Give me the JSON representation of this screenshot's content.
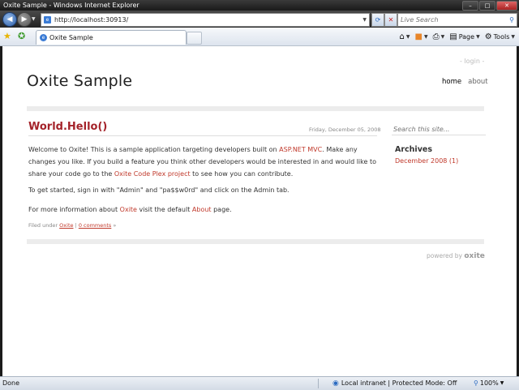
{
  "window": {
    "title": "Oxite Sample - Windows Internet Explorer",
    "minimize_glyph": "–",
    "maximize_glyph": "□",
    "close_glyph": "✕"
  },
  "address_bar": {
    "url": "http://localhost:30913/",
    "search_placeholder": "Live Search"
  },
  "tab": {
    "label": "Oxite Sample"
  },
  "command_bar": {
    "page_label": "Page",
    "tools_label": "Tools"
  },
  "site": {
    "login_label": "- login -",
    "title": "Oxite Sample",
    "nav": [
      "home",
      "about"
    ],
    "search_placeholder": "Search this site...",
    "powered_by_label": "powered by",
    "powered_by_brand": "oxite"
  },
  "post": {
    "title": "World.Hello()",
    "date": "Friday, December 05, 2008",
    "p1_a": "Welcome to Oxite!  This is a sample application targeting developers built on ",
    "p1_link1": "ASP.NET MVC",
    "p1_b": ".  Make any changes you like.  If you build a feature you think other developers would be interested in and would like to share your code go to the ",
    "p1_link2": "Oxite Code Plex project",
    "p1_c": " to see how you can contribute.",
    "p2": "To get started, sign in with \"Admin\" and \"pa$$w0rd\" and click on the Admin tab.",
    "p3_a": "For more information about ",
    "p3_link1": "Oxite",
    "p3_b": " visit the default ",
    "p3_link2": "About",
    "p3_c": " page.",
    "filed_label": "Filed under ",
    "filed_tag": "Oxite",
    "comments_link": "0 comments",
    "comments_suffix": " »"
  },
  "sidebar": {
    "archives_heading": "Archives",
    "archive_items": [
      "December 2008 (1)"
    ]
  },
  "status_bar": {
    "status": "Done",
    "zone": "Local intranet | Protected Mode: Off",
    "zoom": "100%"
  },
  "colors": {
    "accent_link": "#c0392b",
    "post_title": "#a4232a",
    "ie_blue": "#3a7bd5"
  },
  "icons": [
    "back-icon",
    "forward-icon",
    "refresh-icon",
    "stop-icon",
    "search-icon",
    "favorites-star-icon",
    "add-favorites-icon",
    "home-icon",
    "feeds-icon",
    "print-icon",
    "page-icon",
    "tools-icon",
    "globe-icon",
    "zoom-icon"
  ]
}
